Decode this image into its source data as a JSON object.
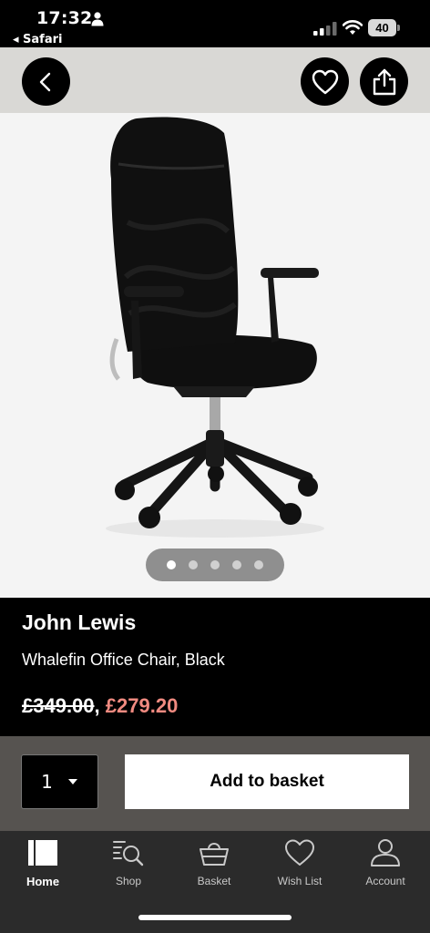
{
  "status_bar": {
    "time": "17:32",
    "back_app": "◂ Safari",
    "battery": "40"
  },
  "product": {
    "brand": "John Lewis",
    "name": "Whalefin Office Chair, Black",
    "old_price": "£349.00",
    "separator": ",",
    "new_price": "£279.20",
    "image_dots": 5,
    "active_image": 1
  },
  "purchase": {
    "quantity": "1",
    "add_label": "Add to basket"
  },
  "tabs": [
    {
      "label": "Home",
      "icon": "home-icon",
      "active": true
    },
    {
      "label": "Shop",
      "icon": "shop-search-icon"
    },
    {
      "label": "Basket",
      "icon": "basket-icon"
    },
    {
      "label": "Wish List",
      "icon": "heart-icon"
    },
    {
      "label": "Account",
      "icon": "account-icon"
    }
  ],
  "colors": {
    "sale_price": "#f08a80",
    "nav_bg": "#d9d8d5",
    "purchase_bg": "#565350"
  }
}
